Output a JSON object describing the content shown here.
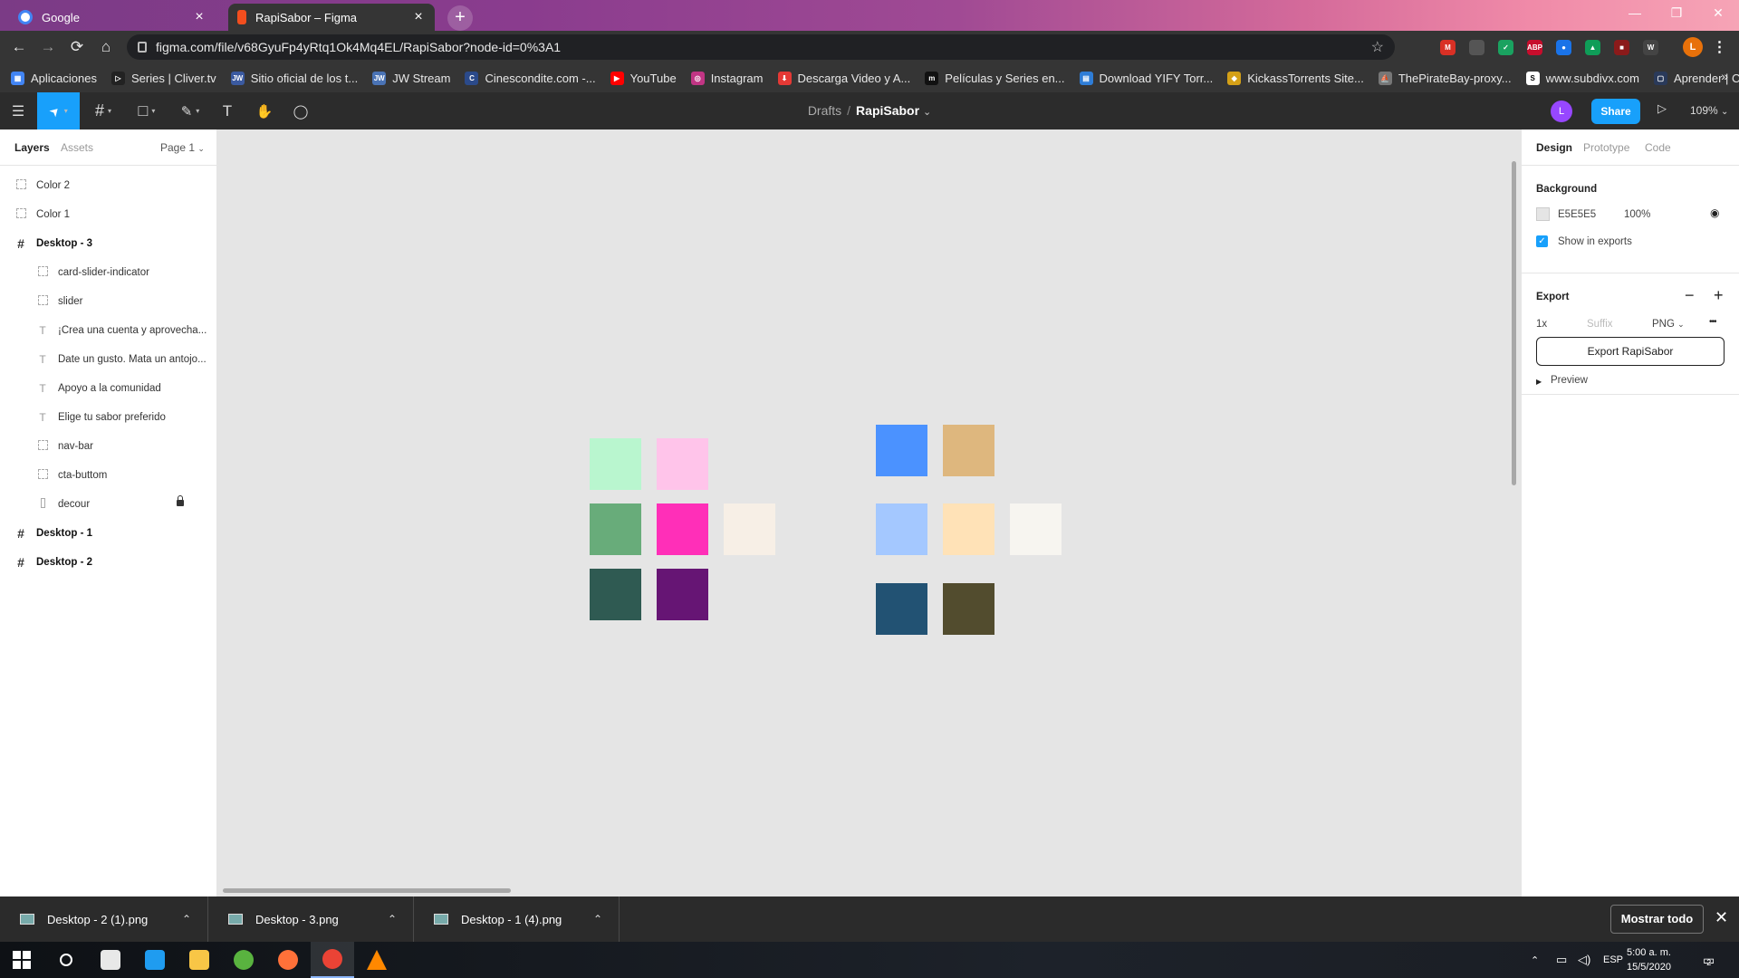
{
  "browser": {
    "tabs": [
      {
        "title": "Google",
        "favicon_color": "#ffffff",
        "active": false
      },
      {
        "title": "RapiSabor – Figma",
        "favicon_color": "#f24e1e",
        "active": true
      }
    ],
    "new_tab": "+",
    "window_controls": {
      "minimize": "—",
      "restore": "❐",
      "close": "✕"
    },
    "nav": {
      "back": "←",
      "forward": "→",
      "reload": "⟳",
      "home": "⌂"
    },
    "url": "figma.com/file/v68GyuFp4yRtq1Ok4Mq4EL/RapiSabor?node-id=0%3A1",
    "star": "☆",
    "extensions": [
      {
        "name": "gmail",
        "label": "M",
        "color": "#d93025"
      },
      {
        "name": "ext-gray",
        "label": "",
        "color": "#555555"
      },
      {
        "name": "ext-check",
        "label": "✓",
        "color": "#1aa260"
      },
      {
        "name": "adblock",
        "label": "ABP",
        "color": "#c70d2c"
      },
      {
        "name": "ext-blue",
        "label": "●",
        "color": "#1a73e8"
      },
      {
        "name": "ext-green",
        "label": "▲",
        "color": "#0f9d58"
      },
      {
        "name": "ext-red",
        "label": "■",
        "color": "#8b1a1a"
      },
      {
        "name": "ext-w",
        "label": "W",
        "color": "#444444"
      }
    ],
    "profile_initial": "L",
    "menu": "⋮"
  },
  "bookmarks": [
    {
      "label": "Aplicaciones",
      "color": "#4285f4",
      "glyph": "▦"
    },
    {
      "label": "Series | Cliver.tv",
      "color": "#222222",
      "glyph": "▷"
    },
    {
      "label": "Sitio oficial de los t...",
      "color": "#3b5aa0",
      "glyph": "JW"
    },
    {
      "label": "JW Stream",
      "color": "#4a73b5",
      "glyph": "JW"
    },
    {
      "label": "Cinescondite.com -...",
      "color": "#2b4a8a",
      "glyph": "C"
    },
    {
      "label": "YouTube",
      "color": "#ff0000",
      "glyph": "▶"
    },
    {
      "label": "Instagram",
      "color": "#c13584",
      "glyph": "◎"
    },
    {
      "label": "Descarga Video y A...",
      "color": "#e53935",
      "glyph": "⬇"
    },
    {
      "label": "Películas y Series en...",
      "color": "#111111",
      "glyph": "m"
    },
    {
      "label": "Download YIFY Torr...",
      "color": "#2e7dd7",
      "glyph": "▤"
    },
    {
      "label": "KickassTorrents Site...",
      "color": "#d4a017",
      "glyph": "◆"
    },
    {
      "label": "ThePirateBay-proxy...",
      "color": "#777777",
      "glyph": "⛵"
    },
    {
      "label": "www.subdivx.com",
      "color": "#ffffff",
      "glyph": "S"
    },
    {
      "label": "Aprender | Codeca...",
      "color": "#2a3a5a",
      "glyph": "▢"
    }
  ],
  "bookmarks_more": "»",
  "figma": {
    "tools": {
      "menu": "☰",
      "move": "➤",
      "frame": "#",
      "shape": "□",
      "pen": "✎",
      "text": "T",
      "hand": "✋",
      "comment": "◯"
    },
    "breadcrumb": {
      "drafts": "Drafts",
      "separator": "/",
      "file": "RapiSabor",
      "caret": "⌄"
    },
    "avatar_initial": "L",
    "share_label": "Share",
    "play": "▷",
    "zoom": "109%",
    "zoom_caret": "⌄"
  },
  "left_panel": {
    "tabs": {
      "layers": "Layers",
      "assets": "Assets",
      "page": "Page 1",
      "page_caret": "⌄"
    },
    "layers": [
      {
        "name": "Color 2",
        "icon": "dash",
        "indent": 1,
        "bold": false,
        "locked": false
      },
      {
        "name": "Color 1",
        "icon": "dash",
        "indent": 1,
        "bold": false,
        "locked": false
      },
      {
        "name": "Desktop - 3",
        "icon": "frame",
        "indent": 1,
        "bold": true,
        "locked": false
      },
      {
        "name": "card-slider-indicator",
        "icon": "dash",
        "indent": 2,
        "bold": false,
        "locked": false
      },
      {
        "name": "slider",
        "icon": "dash",
        "indent": 2,
        "bold": false,
        "locked": false
      },
      {
        "name": "¡Crea una cuenta y aprovecha...",
        "icon": "text",
        "indent": 2,
        "bold": false,
        "locked": false
      },
      {
        "name": "Date un gusto. Mata un antojo...",
        "icon": "text",
        "indent": 2,
        "bold": false,
        "locked": false
      },
      {
        "name": "Apoyo a la comunidad",
        "icon": "text",
        "indent": 2,
        "bold": false,
        "locked": false
      },
      {
        "name": "Elige tu sabor preferido",
        "icon": "text",
        "indent": 2,
        "bold": false,
        "locked": false
      },
      {
        "name": "nav-bar",
        "icon": "dash",
        "indent": 2,
        "bold": false,
        "locked": false
      },
      {
        "name": "cta-buttom",
        "icon": "dash",
        "indent": 2,
        "bold": false,
        "locked": false
      },
      {
        "name": "decour",
        "icon": "rect",
        "indent": 2,
        "bold": false,
        "locked": true
      },
      {
        "name": "Desktop - 1",
        "icon": "frame",
        "indent": 1,
        "bold": true,
        "locked": false
      },
      {
        "name": "Desktop - 2",
        "icon": "frame",
        "indent": 1,
        "bold": true,
        "locked": false
      }
    ]
  },
  "canvas": {
    "background": "#e5e5e5",
    "palette_left": [
      [
        "#b9f6cf",
        "#ffc4ea",
        null
      ],
      [
        "#68ac7a",
        "#ff2fb8",
        "#f7efe6"
      ],
      [
        "#2f5a52",
        "#661574",
        null
      ]
    ],
    "palette_right": [
      [
        "#4b92ff",
        "#deb77e",
        null
      ],
      [
        "#a4c8ff",
        "#ffe2b7",
        "#f7f5f0"
      ],
      [
        "#225273",
        "#524c2e",
        null
      ]
    ],
    "help": "?"
  },
  "right_panel": {
    "tabs": {
      "design": "Design",
      "prototype": "Prototype",
      "code": "Code"
    },
    "background": {
      "title": "Background",
      "hex": "E5E5E5",
      "opacity": "100%",
      "eye": "👁",
      "swatch_color": "#e5e5e5"
    },
    "show_in_exports": "Show in exports",
    "export": {
      "title": "Export",
      "minus": "−",
      "plus": "+",
      "scale": "1x",
      "suffix_placeholder": "Suffix",
      "format": "PNG",
      "format_caret": "⌄",
      "more": "•••",
      "button": "Export RapiSabor",
      "preview": "Preview"
    }
  },
  "downloads": {
    "items": [
      "Desktop - 2 (1).png",
      "Desktop - 3.png",
      "Desktop - 1 (4).png"
    ],
    "chevron": "⌃",
    "show_all": "Mostrar todo",
    "close": "✕"
  },
  "taskbar": {
    "apps": [
      {
        "name": "windows-start",
        "color": "#ffffff"
      },
      {
        "name": "search",
        "color": "#ffffff"
      },
      {
        "name": "store",
        "color": "#e8e8e8"
      },
      {
        "name": "vscode",
        "color": "#1f9cf0"
      },
      {
        "name": "file-explorer",
        "color": "#f8c646"
      },
      {
        "name": "utorrent",
        "color": "#59b33f"
      },
      {
        "name": "firefox",
        "color": "#ff7139"
      },
      {
        "name": "chrome",
        "color": "#ea4335"
      },
      {
        "name": "vlc",
        "color": "#ff8800"
      }
    ],
    "tray_chevron": "⌃",
    "lang": "ESP",
    "time": "5:00 a. m.",
    "date": "15/5/2020",
    "notifications": "2"
  }
}
